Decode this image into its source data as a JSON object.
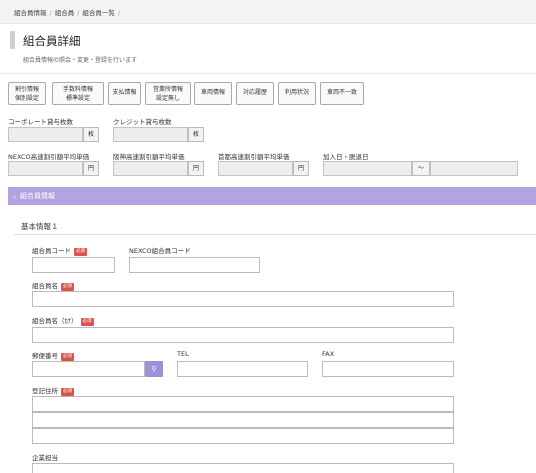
{
  "breadcrumb": [
    "組合員情報",
    "組合員",
    "組合員一覧"
  ],
  "page": {
    "title": "組合員詳細",
    "subtitle": "組合員情報の照会・変更・登録を行います"
  },
  "tabs": [
    {
      "line1": "割引情報",
      "line2": "個別設定"
    },
    {
      "line1": "手数料情報",
      "line2": "標準設定"
    },
    {
      "line1": "支払情報",
      "line2": ""
    },
    {
      "line1": "営業所情報",
      "line2": "設定無し"
    },
    {
      "line1": "車両情報",
      "line2": ""
    },
    {
      "line1": "対応履歴",
      "line2": ""
    },
    {
      "line1": "利用状況",
      "line2": ""
    },
    {
      "line1": "車両不一致",
      "line2": ""
    }
  ],
  "summary": {
    "corporate_label": "コーポレート貸与枚数",
    "credit_label": "クレジット貸与枚数",
    "unit_mai": "枚",
    "nexco_label": "NEXCO高速割引額平均単価",
    "hanshin_label": "阪神高速割引額平均単価",
    "shuto_label": "首都高速割引額平均単価",
    "unit_yen": "円",
    "join_date_label": "加入日・脱退日",
    "range_sep": "～"
  },
  "section": {
    "title": "組合員情報",
    "subsection": "基本情報１"
  },
  "form": {
    "required": "必須",
    "member_code": "組合員コード",
    "nexco_member_code": "NEXCO組合員コード",
    "member_name": "組合員名",
    "member_name_kana": "組合員名（ｶﾅ）",
    "postal_code": "郵便番号",
    "tel": "TEL",
    "fax": "FAX",
    "registered_address": "登記住所",
    "company_contact": "企業担当"
  },
  "icons": {
    "search": "search-icon",
    "chevron": "chevron-down-icon"
  },
  "colors": {
    "section_bar": "#b3a3df",
    "search_button": "#9d8fd8",
    "required_badge": "#d9534f"
  }
}
